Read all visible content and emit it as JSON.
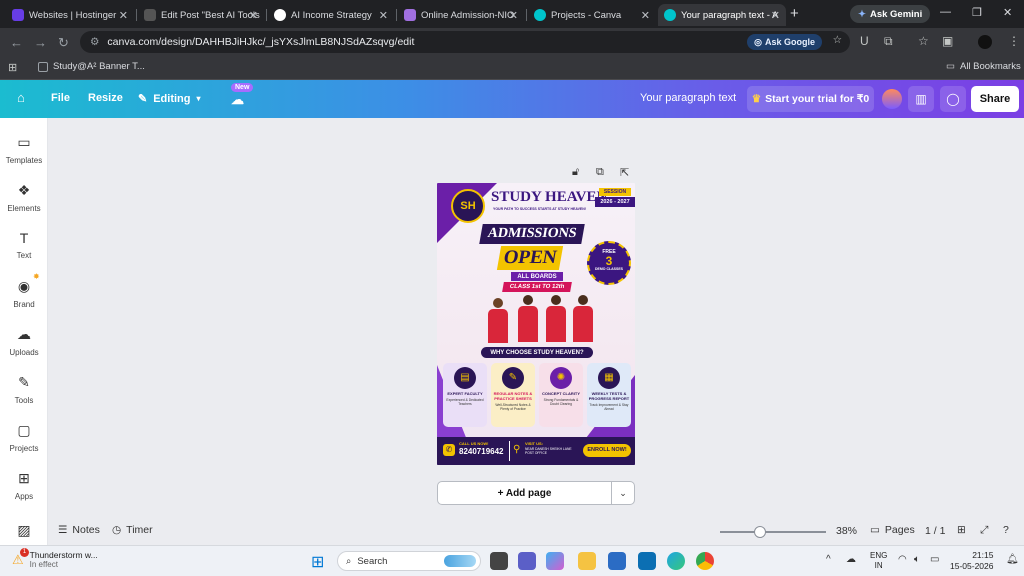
{
  "browser": {
    "tabs": [
      {
        "title": "Websites | Hostinger",
        "color": "#673de6"
      },
      {
        "title": "Edit Post \"Best AI Tools",
        "color": "#2a2a2a"
      },
      {
        "title": "AI Income Strategy",
        "color": "#ffffff"
      },
      {
        "title": "Online Admission-NIO",
        "color": "#a06fe0"
      },
      {
        "title": "Projects - Canva",
        "color": "#00c4cc"
      },
      {
        "title": "Your paragraph text - A",
        "color": "#00c4cc"
      }
    ],
    "new_tab": "+",
    "ask_gemini": "Ask Gemini",
    "url": "canva.com/design/DAHHBJiHJkc/_jsYXsJlmLB8NJSdAZsqvg/edit",
    "ask_google": "Ask Google",
    "bookmark": "Study@A² Banner T...",
    "all_bookmarks": "All Bookmarks"
  },
  "canva_header": {
    "file": "File",
    "resize": "Resize",
    "editing": "Editing",
    "new_badge": "New",
    "doc_title": "Your paragraph text",
    "trial": "Start your trial for ₹0",
    "share": "Share"
  },
  "sidebar": [
    {
      "label": "Templates",
      "icon": "▭"
    },
    {
      "label": "Elements",
      "icon": "❖"
    },
    {
      "label": "Text",
      "icon": "T"
    },
    {
      "label": "Brand",
      "icon": "◉"
    },
    {
      "label": "Uploads",
      "icon": "☁"
    },
    {
      "label": "Tools",
      "icon": "✎"
    },
    {
      "label": "Projects",
      "icon": "▢"
    },
    {
      "label": "Apps",
      "icon": "⊞"
    }
  ],
  "poster": {
    "brand_name": "STUDY HEAVEN",
    "tagline": "YOUR PATH TO SUCCESS STARTS AT STUDY HEAVEN!",
    "logo": "SH",
    "session_label": "SESSION",
    "session_years": "2026 - 2027",
    "admissions": "ADMISSIONS",
    "open": "OPEN",
    "all_boards": "ALL BOARDS",
    "class_range": "CLASS 1st TO 12th",
    "free": "FREE",
    "free_num": "3",
    "demo": "DEMO CLASSES",
    "why_choose": "WHY CHOOSE STUDY HEAVEN?",
    "features": [
      {
        "title": "EXPERT FACULTY",
        "desc": "Experienced & Dedicated Teachers",
        "bg": "#eadff7"
      },
      {
        "title": "REGULAR NOTES & PRACTICE SHEETS",
        "desc": "Well-Structured Notes & Plenty of Practice",
        "bg": "#fbeec6"
      },
      {
        "title": "CONCEPT CLARITY",
        "desc": "Strong Fundamentals & Doubt Clearing",
        "bg": "#f7dfe9"
      },
      {
        "title": "WEEKLY TESTS & PROGRESS REPORT",
        "desc": "Track Improvement & Stay Ahead",
        "bg": "#dfe9f8"
      }
    ],
    "call_label": "CALL US NOW!",
    "phone": "8240719642",
    "visit_label": "VISIT US:",
    "address": "NEAR DANESH SHEIKH LANE POST OFFICE",
    "enroll": "ENROLL NOW!"
  },
  "canvas": {
    "add_page": "+ Add page"
  },
  "footer": {
    "notes": "Notes",
    "timer": "Timer",
    "zoom": "38%",
    "zoom_fraction": 0.38,
    "pages": "Pages",
    "page_count": "1 / 1"
  },
  "taskbar": {
    "weather_title": "Thunderstorm w...",
    "weather_sub": "In effect",
    "weather_badge": "1",
    "search": "Search",
    "lang1": "ENG",
    "lang2": "IN",
    "time": "21:15",
    "date": "15-05-2026"
  }
}
